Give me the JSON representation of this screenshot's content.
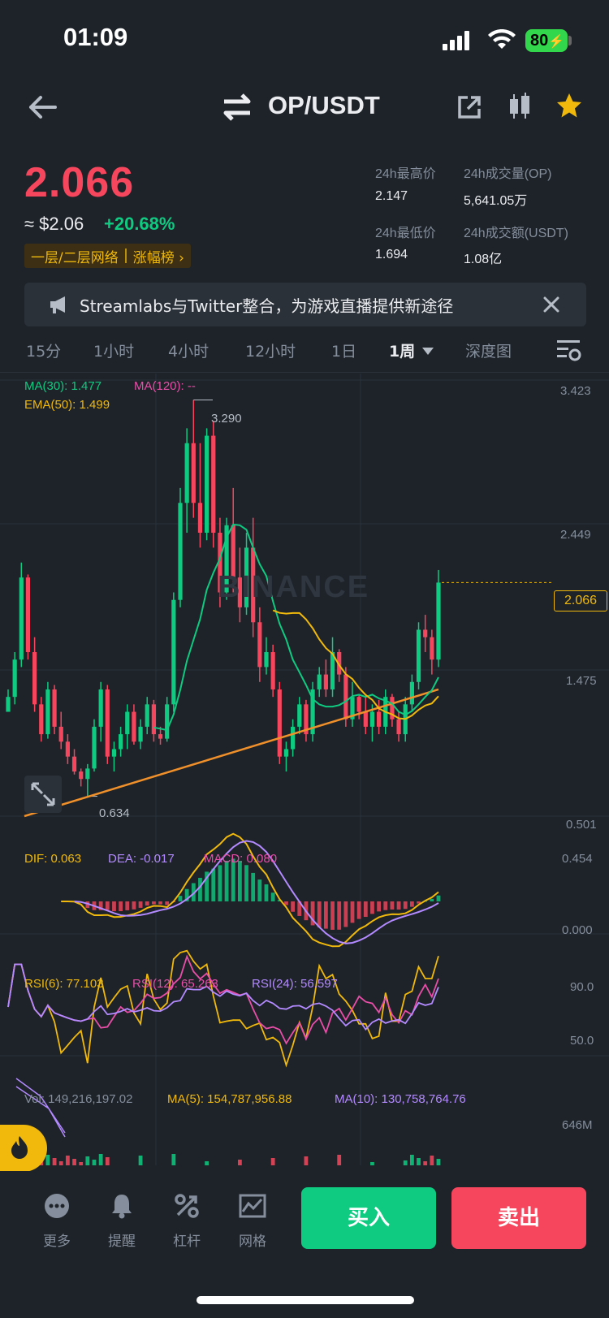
{
  "status": {
    "time": "01:09",
    "battery": "80"
  },
  "header": {
    "pair": "OP/USDT"
  },
  "ticker": {
    "price": "2.066",
    "usd_price": "≈ $2.06",
    "change": "+20.68%",
    "tags": [
      "一层/二层网络",
      "涨幅榜 ›"
    ],
    "stats": [
      {
        "label": "24h最高价",
        "value": "2.147"
      },
      {
        "label": "24h成交量(OP)",
        "value": "5,641.05万"
      },
      {
        "label": "24h最低价",
        "value": "1.694"
      },
      {
        "label": "24h成交额(USDT)",
        "value": "1.08亿"
      }
    ]
  },
  "notice": {
    "text": "Streamlabs与Twitter整合，为游戏直播提供新途径"
  },
  "tabs": [
    "15分",
    "1小时",
    "4小时",
    "12小时",
    "1日",
    "1周",
    "深度图"
  ],
  "active_tab": "1周",
  "indicators": {
    "ma30": "MA(30): 1.477",
    "ma120": "MA(120): --",
    "ema50": "EMA(50): 1.499",
    "dif": "DIF: 0.063",
    "dea": "DEA: -0.017",
    "macd": "MACD: 0.080",
    "rsi6": "RSI(6): 77.103",
    "rsi12": "RSI(12): 65.263",
    "rsi24": "RSI(24): 56.597",
    "vol": "Vol: 149,216,197.02",
    "vol_ma5": "MA(5): 154,787,956.88",
    "vol_ma10": "MA(10): 130,758,764.76"
  },
  "axes": {
    "price": [
      "3.423",
      "2.449",
      "1.475",
      "0.501"
    ],
    "macd": [
      "0.454",
      "0.000"
    ],
    "rsi": [
      "90.0",
      "50.0"
    ],
    "vol": [
      "646M"
    ],
    "high_mark": "3.290",
    "low_mark": "0.634",
    "current": "2.066"
  },
  "watermark": "BINANCE",
  "colors": {
    "up": "#0ecb81",
    "down": "#f6465d",
    "accent": "#f0b90b",
    "bg": "#1e2329"
  },
  "nav": [
    {
      "label": "更多",
      "icon": "more-icon"
    },
    {
      "label": "提醒",
      "icon": "bell-icon"
    },
    {
      "label": "杠杆",
      "icon": "percent-icon"
    },
    {
      "label": "网格",
      "icon": "grid-chart-icon"
    }
  ],
  "actions": {
    "buy": "买入",
    "sell": "卖出"
  },
  "chart_data": {
    "type": "candlestick",
    "title": "",
    "y_range": [
      0.501,
      3.423
    ],
    "price_ticks": [
      3.423,
      2.449,
      1.475,
      0.501
    ],
    "marked_high": 3.29,
    "marked_low": 0.634,
    "last_price": 2.066,
    "ohlc": [
      [
        1.2,
        1.35,
        1.25,
        1.3
      ],
      [
        1.3,
        1.6,
        1.25,
        1.55
      ],
      [
        1.55,
        2.2,
        1.5,
        2.1
      ],
      [
        2.1,
        2.12,
        1.55,
        1.6
      ],
      [
        1.6,
        1.7,
        1.2,
        1.25
      ],
      [
        1.25,
        1.3,
        1.0,
        1.05
      ],
      [
        1.05,
        1.4,
        1.02,
        1.35
      ],
      [
        1.35,
        1.38,
        1.05,
        1.1
      ],
      [
        1.1,
        1.2,
        0.95,
        1.0
      ],
      [
        1.0,
        1.05,
        0.85,
        0.9
      ],
      [
        0.9,
        0.95,
        0.78,
        0.8
      ],
      [
        0.8,
        0.82,
        0.7,
        0.75
      ],
      [
        0.75,
        0.85,
        0.63,
        0.82
      ],
      [
        0.82,
        1.15,
        0.8,
        1.1
      ],
      [
        1.1,
        1.4,
        1.0,
        1.35
      ],
      [
        1.35,
        1.38,
        0.85,
        0.9
      ],
      [
        0.9,
        1.0,
        0.8,
        0.95
      ],
      [
        0.95,
        1.1,
        0.9,
        1.05
      ],
      [
        1.05,
        1.25,
        0.95,
        1.2
      ],
      [
        1.2,
        1.25,
        0.98,
        1.0
      ],
      [
        1.0,
        1.15,
        0.95,
        1.1
      ],
      [
        1.1,
        1.3,
        1.05,
        1.25
      ],
      [
        1.25,
        1.28,
        1.0,
        1.05
      ],
      [
        1.05,
        1.1,
        0.98,
        1.02
      ],
      [
        1.02,
        1.3,
        1.0,
        1.25
      ],
      [
        1.25,
        2.0,
        1.2,
        1.95
      ],
      [
        1.95,
        2.7,
        1.9,
        2.6
      ],
      [
        2.6,
        3.1,
        2.4,
        3.0
      ],
      [
        3.0,
        3.29,
        2.5,
        2.6
      ],
      [
        2.6,
        3.0,
        2.3,
        2.4
      ],
      [
        2.4,
        3.1,
        2.35,
        3.05
      ],
      [
        3.05,
        3.15,
        2.3,
        2.4
      ],
      [
        2.4,
        2.5,
        1.9,
        2.0
      ],
      [
        2.0,
        2.5,
        1.95,
        2.45
      ],
      [
        2.45,
        2.7,
        2.0,
        2.1
      ],
      [
        2.1,
        2.3,
        1.8,
        1.9
      ],
      [
        1.9,
        2.4,
        1.85,
        2.3
      ],
      [
        2.3,
        2.5,
        1.7,
        1.8
      ],
      [
        1.8,
        1.9,
        1.4,
        1.5
      ],
      [
        1.5,
        1.7,
        1.45,
        1.6
      ],
      [
        1.6,
        1.65,
        1.3,
        1.35
      ],
      [
        1.35,
        1.4,
        0.85,
        0.9
      ],
      [
        0.9,
        1.0,
        0.8,
        0.95
      ],
      [
        0.95,
        1.15,
        0.9,
        1.1
      ],
      [
        1.1,
        1.3,
        1.05,
        1.25
      ],
      [
        1.25,
        1.28,
        1.0,
        1.05
      ],
      [
        1.05,
        1.4,
        1.0,
        1.35
      ],
      [
        1.35,
        1.5,
        1.3,
        1.45
      ],
      [
        1.45,
        1.55,
        1.3,
        1.35
      ],
      [
        1.35,
        1.7,
        1.3,
        1.6
      ],
      [
        1.6,
        1.62,
        1.4,
        1.45
      ],
      [
        1.45,
        1.5,
        1.1,
        1.15
      ],
      [
        1.15,
        1.4,
        1.1,
        1.3
      ],
      [
        1.3,
        1.32,
        1.15,
        1.2
      ],
      [
        1.2,
        1.3,
        1.05,
        1.1
      ],
      [
        1.1,
        1.25,
        1.0,
        1.2
      ],
      [
        1.2,
        1.28,
        1.05,
        1.1
      ],
      [
        1.1,
        1.35,
        1.05,
        1.3
      ],
      [
        1.3,
        1.32,
        1.1,
        1.15
      ],
      [
        1.15,
        1.2,
        1.0,
        1.05
      ],
      [
        1.05,
        1.3,
        1.0,
        1.25
      ],
      [
        1.25,
        1.45,
        1.2,
        1.4
      ],
      [
        1.4,
        1.8,
        1.35,
        1.75
      ],
      [
        1.75,
        1.85,
        1.6,
        1.7
      ],
      [
        1.7,
        1.75,
        1.45,
        1.55
      ],
      [
        1.55,
        2.15,
        1.5,
        2.066
      ]
    ]
  }
}
